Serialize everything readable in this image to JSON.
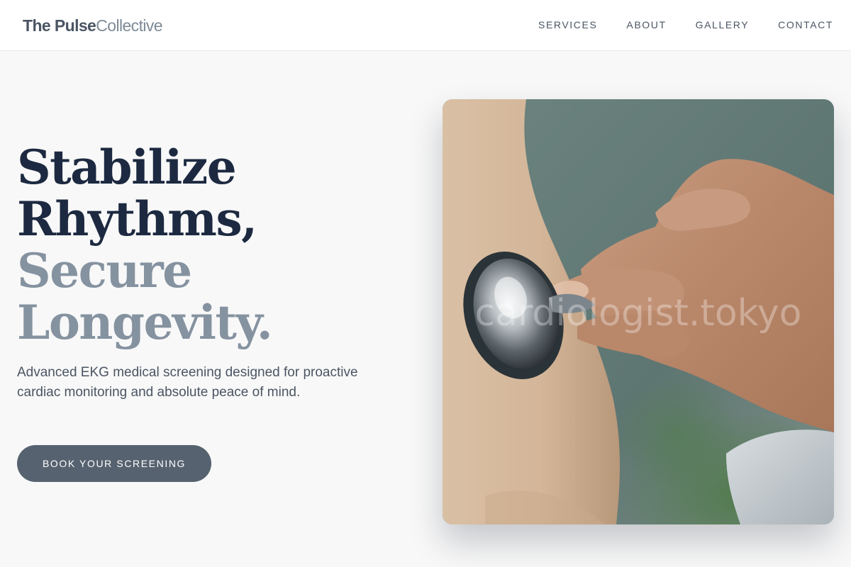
{
  "header": {
    "logo_primary": "The Pulse",
    "logo_secondary": "Collective",
    "nav": [
      {
        "label": "SERVICES"
      },
      {
        "label": "ABOUT"
      },
      {
        "label": "GALLERY"
      },
      {
        "label": "CONTACT"
      }
    ]
  },
  "hero": {
    "title_lines": [
      "Stabilize",
      "Rhythms,",
      "Secure",
      "Longevity."
    ],
    "subtitle": "Advanced EKG medical screening designed for proactive cardiac monitoring and absolute peace of mind.",
    "cta_label": "BOOK YOUR SCREENING",
    "image": {
      "depicts": "stethoscope-on-chest",
      "watermark": "cardiologist.tokyo"
    }
  },
  "colors": {
    "background": "#f8f8f8",
    "header_bg": "#ffffff",
    "title_dark": "#1c2940",
    "title_muted": "#8592a0",
    "body_text": "#4b5563",
    "button_bg": "#56626f",
    "button_text": "#ffffff"
  }
}
